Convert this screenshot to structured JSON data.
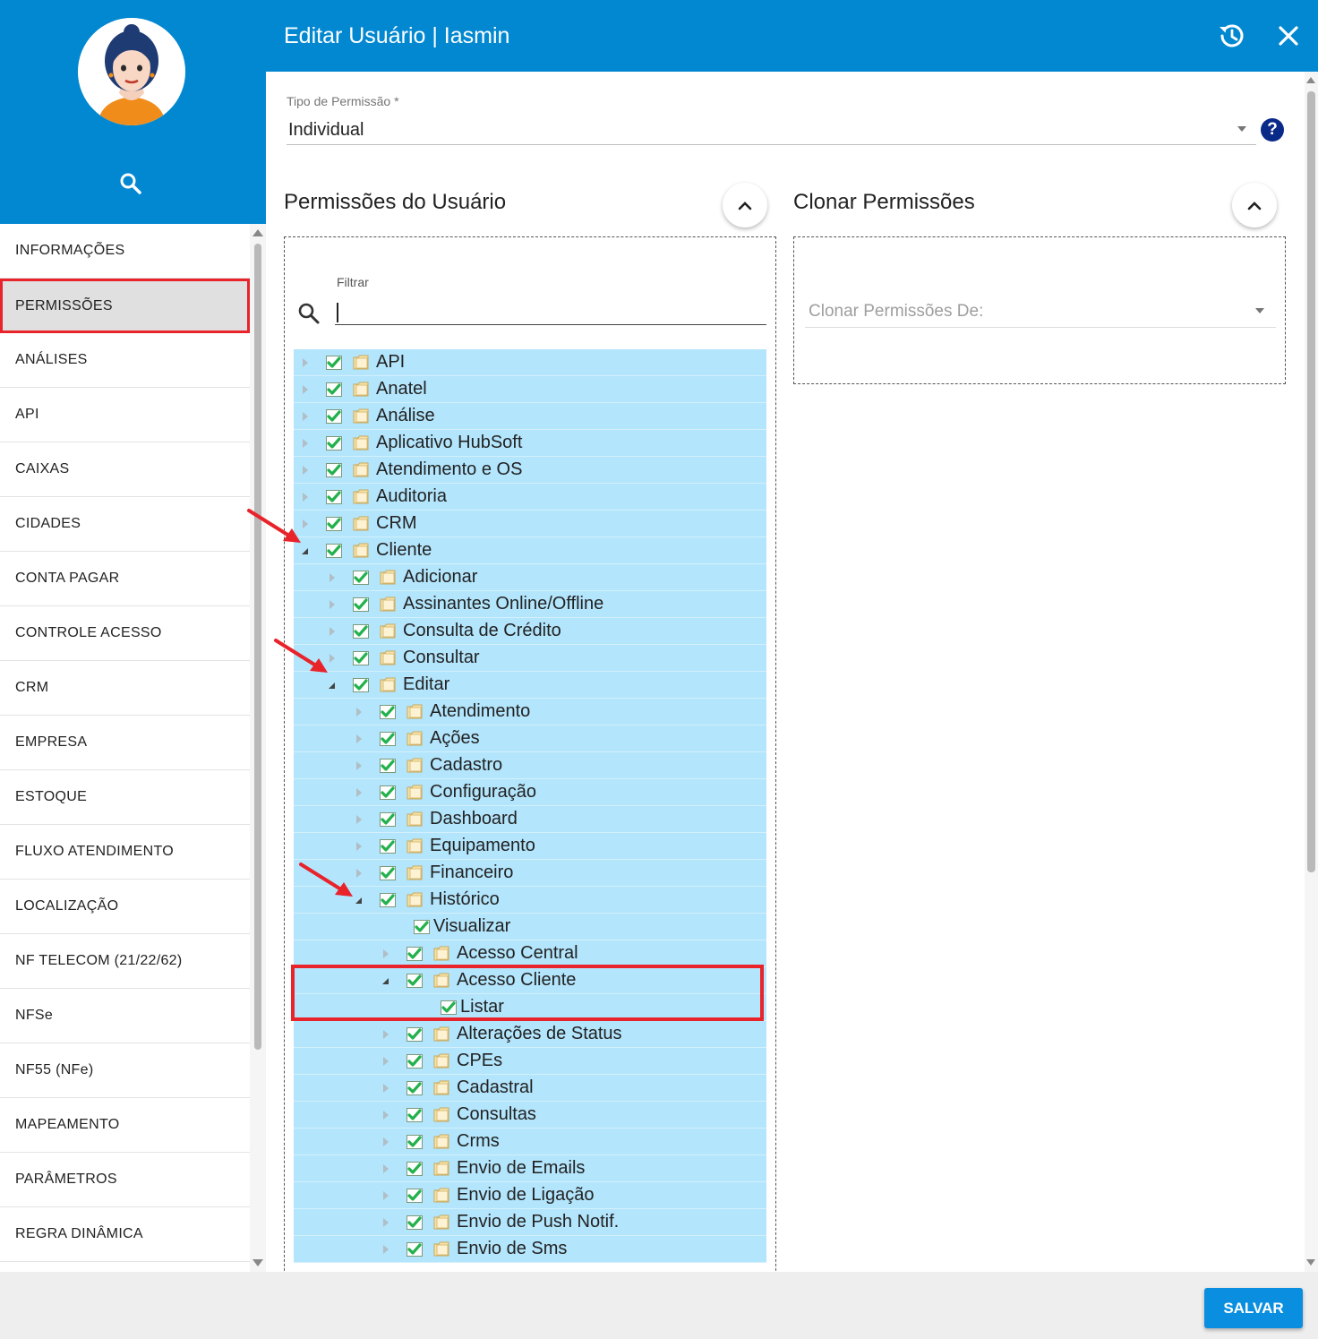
{
  "window": {
    "title": "Editar Usuário | Iasmin"
  },
  "sidebar": {
    "items": [
      {
        "label": "INFORMAÇÕES",
        "active": false
      },
      {
        "label": "PERMISSÕES",
        "active": true
      },
      {
        "label": "ANÁLISES",
        "active": false
      },
      {
        "label": "API",
        "active": false
      },
      {
        "label": "CAIXAS",
        "active": false
      },
      {
        "label": "CIDADES",
        "active": false
      },
      {
        "label": "CONTA PAGAR",
        "active": false
      },
      {
        "label": "CONTROLE ACESSO",
        "active": false
      },
      {
        "label": "CRM",
        "active": false
      },
      {
        "label": "EMPRESA",
        "active": false
      },
      {
        "label": "ESTOQUE",
        "active": false
      },
      {
        "label": "FLUXO ATENDIMENTO",
        "active": false
      },
      {
        "label": "LOCALIZAÇÃO",
        "active": false
      },
      {
        "label": "NF TELECOM (21/22/62)",
        "active": false
      },
      {
        "label": "NFSe",
        "active": false
      },
      {
        "label": "NF55 (NFe)",
        "active": false
      },
      {
        "label": "MAPEAMENTO",
        "active": false
      },
      {
        "label": "PARÂMETROS",
        "active": false
      },
      {
        "label": "REGRA DINÂMICA",
        "active": false
      }
    ]
  },
  "permission_type": {
    "label": "Tipo de Permissão *",
    "value": "Individual"
  },
  "user_permissions": {
    "title": "Permissões do Usuário",
    "filter_label": "Filtrar",
    "tree": [
      {
        "label": "API",
        "level": 0,
        "toggle": "closed",
        "folder": true
      },
      {
        "label": "Anatel",
        "level": 0,
        "toggle": "closed",
        "folder": true
      },
      {
        "label": "Análise",
        "level": 0,
        "toggle": "closed",
        "folder": true
      },
      {
        "label": "Aplicativo HubSoft",
        "level": 0,
        "toggle": "closed",
        "folder": true
      },
      {
        "label": "Atendimento e OS",
        "level": 0,
        "toggle": "closed",
        "folder": true
      },
      {
        "label": "Auditoria",
        "level": 0,
        "toggle": "closed",
        "folder": true
      },
      {
        "label": "CRM",
        "level": 0,
        "toggle": "closed",
        "folder": true
      },
      {
        "label": "Cliente",
        "level": 0,
        "toggle": "open",
        "folder": true
      },
      {
        "label": "Adicionar",
        "level": 1,
        "toggle": "closed",
        "folder": true
      },
      {
        "label": "Assinantes Online/Offline",
        "level": 1,
        "toggle": "closed",
        "folder": true
      },
      {
        "label": "Consulta de Crédito",
        "level": 1,
        "toggle": "closed",
        "folder": true
      },
      {
        "label": "Consultar",
        "level": 1,
        "toggle": "closed",
        "folder": true
      },
      {
        "label": "Editar",
        "level": 1,
        "toggle": "open",
        "folder": true
      },
      {
        "label": "Atendimento",
        "level": 2,
        "toggle": "closed",
        "folder": true
      },
      {
        "label": "Ações",
        "level": 2,
        "toggle": "closed",
        "folder": true
      },
      {
        "label": "Cadastro",
        "level": 2,
        "toggle": "closed",
        "folder": true
      },
      {
        "label": "Configuração",
        "level": 2,
        "toggle": "closed",
        "folder": true
      },
      {
        "label": "Dashboard",
        "level": 2,
        "toggle": "closed",
        "folder": true
      },
      {
        "label": "Equipamento",
        "level": 2,
        "toggle": "closed",
        "folder": true
      },
      {
        "label": "Financeiro",
        "level": 2,
        "toggle": "closed",
        "folder": true
      },
      {
        "label": "Histórico",
        "level": 2,
        "toggle": "open",
        "folder": true
      },
      {
        "label": "Visualizar",
        "level": 3,
        "toggle": "none",
        "folder": false
      },
      {
        "label": "Acesso Central",
        "level": 3,
        "toggle": "closed",
        "folder": true
      },
      {
        "label": "Acesso Cliente",
        "level": 3,
        "toggle": "open",
        "folder": true
      },
      {
        "label": "Listar",
        "level": 4,
        "toggle": "none",
        "folder": false
      },
      {
        "label": "Alterações de Status",
        "level": 3,
        "toggle": "closed",
        "folder": true
      },
      {
        "label": "CPEs",
        "level": 3,
        "toggle": "closed",
        "folder": true
      },
      {
        "label": "Cadastral",
        "level": 3,
        "toggle": "closed",
        "folder": true
      },
      {
        "label": "Consultas",
        "level": 3,
        "toggle": "closed",
        "folder": true
      },
      {
        "label": "Crms",
        "level": 3,
        "toggle": "closed",
        "folder": true
      },
      {
        "label": "Envio de Emails",
        "level": 3,
        "toggle": "closed",
        "folder": true
      },
      {
        "label": "Envio de Ligação",
        "level": 3,
        "toggle": "closed",
        "folder": true
      },
      {
        "label": "Envio de Push Notif.",
        "level": 3,
        "toggle": "closed",
        "folder": true
      },
      {
        "label": "Envio de Sms",
        "level": 3,
        "toggle": "closed",
        "folder": true
      }
    ]
  },
  "clone_permissions": {
    "title": "Clonar Permissões",
    "placeholder": "Clonar Permissões De:"
  },
  "footer": {
    "save_label": "SALVAR"
  },
  "colors": {
    "brand": "#0288d1",
    "tree_row": "#b3e5fc",
    "highlight": "#e8232a",
    "save_button": "#0a8ee0"
  },
  "icons": {
    "search": "search-icon",
    "history": "history-icon",
    "close": "close-icon",
    "help": "help-icon",
    "collapse": "chevron-up-icon",
    "checkbox": "checkbox-checked-icon",
    "folder": "folder-icon"
  }
}
